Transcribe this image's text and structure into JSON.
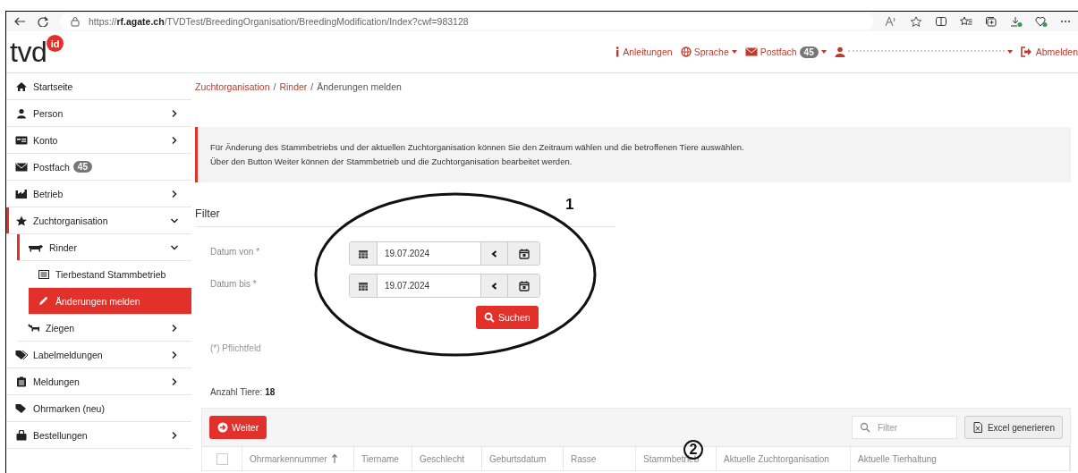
{
  "browser": {
    "url": "https://**rf.agate.ch**/TVDTest/BreedingOrganisation/BreedingModification/Index?cwf=983128"
  },
  "header": {
    "logo": "tvd",
    "logo_badge": "id",
    "nav": [
      {
        "kind": "link",
        "label": "Anleitungen",
        "dropdown": false
      },
      {
        "kind": "link",
        "label": "Sprache",
        "dropdown": true
      },
      {
        "kind": "link",
        "label": "Postfach",
        "badge": "45",
        "dropdown": true
      },
      {
        "kind": "user",
        "dropdown": true
      },
      {
        "kind": "link",
        "label": "Abmelden",
        "dropdown": false
      }
    ]
  },
  "sidebar": {
    "items": [
      {
        "label": "Startseite",
        "kind": "link",
        "expanded": false,
        "selected": false
      },
      {
        "label": "Person",
        "kind": "group",
        "expanded": false,
        "selected": false
      },
      {
        "label": "Konto",
        "kind": "group",
        "expanded": false,
        "selected": false
      },
      {
        "label": "Postfach",
        "badge": "45",
        "kind": "link",
        "expanded": false,
        "selected": false
      },
      {
        "label": "Betrieb",
        "kind": "group",
        "expanded": false,
        "selected": false
      },
      {
        "label": "Zuchtorganisation",
        "kind": "group",
        "expanded": true,
        "selected": false,
        "children": [
          {
            "label": "Rinder",
            "kind": "group",
            "expanded": true,
            "selected": false,
            "children": [
              {
                "label": "Tierbestand Stammbetrieb",
                "kind": "link",
                "expanded": false,
                "selected": false
              },
              {
                "label": "Änderungen melden",
                "kind": "link",
                "expanded": false,
                "selected": true
              }
            ]
          },
          {
            "label": "Ziegen",
            "kind": "group",
            "expanded": false,
            "selected": false
          }
        ]
      },
      {
        "label": "Labelmeldungen",
        "kind": "group",
        "expanded": false,
        "selected": false
      },
      {
        "label": "Meldungen",
        "kind": "group",
        "expanded": false,
        "selected": false
      },
      {
        "label": "Ohrmarken (neu)",
        "kind": "link",
        "expanded": false,
        "selected": false
      },
      {
        "label": "Bestellungen",
        "kind": "group",
        "expanded": false,
        "selected": false
      }
    ]
  },
  "breadcrumb": [
    {
      "label": "Zuchtorganisation",
      "link": true,
      "separator": "/"
    },
    {
      "label": "Rinder",
      "link": true,
      "separator": "/"
    },
    {
      "label": "Änderungen melden",
      "link": false
    }
  ],
  "notice": {
    "lines": [
      "Für Änderung des Stammbetriebs und der aktuellen Zuchtorganisation können Sie den Zeitraum wählen und die betroffenen Tiere auswählen.",
      "Über den Button Weiter können der Stammbetrieb und die Zuchtorganisation bearbeitet werden."
    ]
  },
  "filter": {
    "title": "Filter",
    "annotation": "1",
    "fields": [
      {
        "label": "Datum von *",
        "value": "19.07.2024"
      },
      {
        "label": "Datum bis *",
        "value": "19.07.2024"
      }
    ],
    "search_button": "Suchen",
    "required_note": "(*) Pflichtfeld"
  },
  "count": "Anzahl Tiere: **18**",
  "table": {
    "next_button": "Weiter",
    "filter": {
      "placeholder": "Filter"
    },
    "export_button": "Excel generieren",
    "annotation": "2",
    "select_all_checked": false,
    "columns": [
      {
        "label": "Ohrmarkennummer",
        "sorted": true
      },
      {
        "label": "Tiername",
        "sorted": false
      },
      {
        "label": "Geschlecht",
        "sorted": false
      },
      {
        "label": "Geburtsdatum",
        "sorted": false
      },
      {
        "label": "Rasse",
        "sorted": false
      },
      {
        "label": "Stammbetrieb",
        "sorted": false
      },
      {
        "label": "Aktuelle Zuchtorganisation",
        "sorted": false
      },
      {
        "label": "Aktuelle Tierhaltung",
        "sorted": false
      }
    ]
  }
}
